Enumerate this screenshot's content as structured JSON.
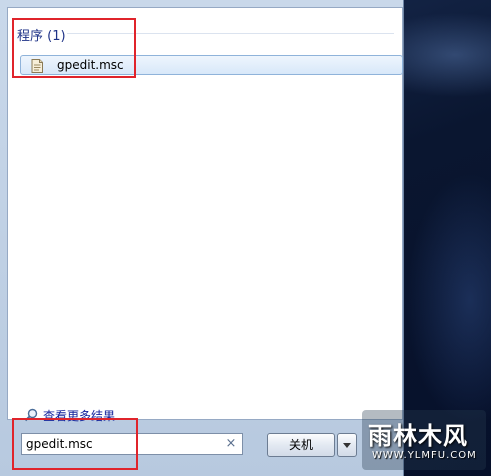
{
  "results": {
    "group_header": "程序 (1)",
    "items": [
      {
        "label": "gpedit.msc",
        "icon": "document-icon"
      }
    ]
  },
  "see_more": {
    "label": "查看更多结果",
    "icon": "magnifier-icon"
  },
  "search": {
    "value": "gpedit.msc",
    "clear_glyph": "×"
  },
  "shutdown": {
    "label": "关机"
  },
  "watermark": {
    "main": "雨林木风",
    "sub": "WWW.YLMFU.COM"
  },
  "colors": {
    "highlight": "#e0242b",
    "group_header": "#1e3287",
    "link": "#13239c"
  }
}
